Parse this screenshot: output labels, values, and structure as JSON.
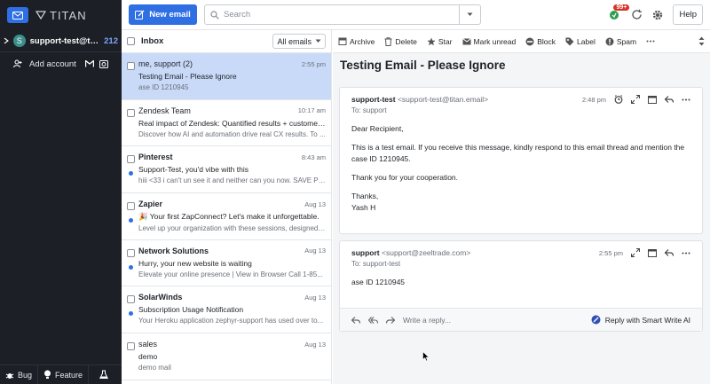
{
  "brand": {
    "name": "TITAN"
  },
  "account": {
    "initial": "S",
    "email": "support-test@titan.email",
    "display": "support-test@titan....",
    "unread_count": "212"
  },
  "sidebar": {
    "add_account": "Add account"
  },
  "bottom": {
    "bug": "Bug",
    "feature": "Feature"
  },
  "topbar": {
    "new_email": "New email",
    "search_placeholder": "Search",
    "notif_count": "99+",
    "help": "Help"
  },
  "list": {
    "title": "Inbox",
    "filter": "All emails",
    "items": [
      {
        "sender": "me, support (2)",
        "time": "2:55 pm",
        "subject": "Testing Email - Please Ignore",
        "preview": "ase ID 1210945",
        "unread": false,
        "selected": true
      },
      {
        "sender": "Zendesk Team",
        "time": "10:17 am",
        "subject": "Real impact of Zendesk: Quantified results + customer story",
        "preview": "Discover how AI and automation drive real CX results. To ...",
        "unread": false,
        "selected": false
      },
      {
        "sender": "Pinterest",
        "time": "8:43 am",
        "subject": "Support-Test, you'd vibe with this",
        "preview": "hiii <33 i can't un see it and neither can you now. SAVE PL...",
        "unread": true,
        "selected": false
      },
      {
        "sender": "Zapier",
        "time": "Aug 13",
        "subject": "🎉 Your first ZapConnect? Let's make it unforgettable.",
        "preview": "Level up your organization with these sessions, designed ...",
        "unread": true,
        "selected": false
      },
      {
        "sender": "Network Solutions",
        "time": "Aug 13",
        "subject": "Hurry, your new website is waiting",
        "preview": "Elevate your online presence  |  View in Browser Call 1-85...",
        "unread": true,
        "selected": false
      },
      {
        "sender": "SolarWinds",
        "time": "Aug 13",
        "subject": "Subscription Usage Notification",
        "preview": "Your Heroku application zephyr-support has used over to...",
        "unread": true,
        "selected": false
      },
      {
        "sender": "sales",
        "time": "Aug 13",
        "subject": "demo",
        "preview": "demo mail",
        "unread": false,
        "selected": false
      }
    ]
  },
  "toolbar": {
    "archive": "Archive",
    "delete": "Delete",
    "star": "Star",
    "mark_unread": "Mark unread",
    "block": "Block",
    "label": "Label",
    "spam": "Spam"
  },
  "thread": {
    "subject": "Testing Email - Please Ignore",
    "messages": [
      {
        "from_name": "support-test",
        "from_addr": "<support-test@titan.email>",
        "to": "To: support",
        "time": "2:48 pm",
        "body": [
          "Dear Recipient,",
          "This is a test email. If you receive this message, kindly respond to this email thread and mention the case ID 1210945.",
          "Thank you for your cooperation.",
          "Thanks,"
        ],
        "signature_name": "Yash H"
      },
      {
        "from_name": "support",
        "from_addr": "<support@zeeltrade.com>",
        "to": "To: support-test",
        "time": "2:55 pm",
        "body": [
          "ase ID 1210945"
        ]
      }
    ],
    "reply_placeholder": "Write a reply...",
    "smart_write": "Reply with Smart Write AI"
  },
  "colors": {
    "accent": "#2f6fe4",
    "sidebar_bg": "#1c1f26",
    "selected_bg": "#c9daf8",
    "badge": "#d93025"
  }
}
